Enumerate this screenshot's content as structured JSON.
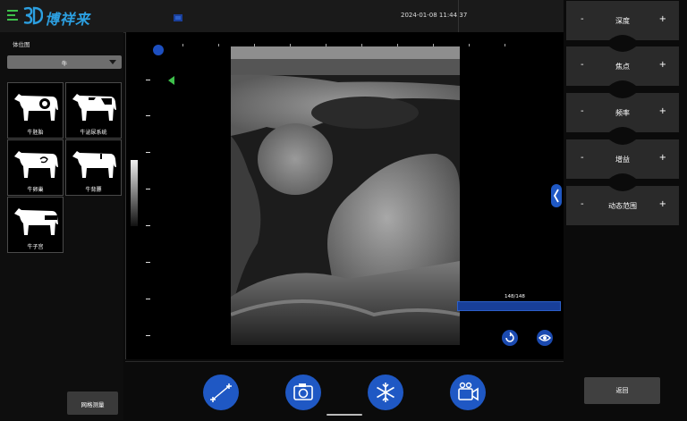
{
  "header": {
    "brand": "博祥来",
    "datetime": "2024-01-08 11:44:37"
  },
  "left_panel": {
    "title": "体位图",
    "selected_animal": "牛",
    "thumbnails": [
      {
        "label": "牛胚胎"
      },
      {
        "label": "牛泌尿系统"
      },
      {
        "label": "牛卵巢"
      },
      {
        "label": "牛背膘"
      },
      {
        "label": "牛子宫"
      }
    ],
    "grid_measure_label": "网格测量"
  },
  "image": {
    "frame_counter": "148/148",
    "cine_progress": 1.0
  },
  "toolbar": {
    "icons": [
      "measure-icon",
      "camera-icon",
      "freeze-icon",
      "video-icon"
    ]
  },
  "controls": {
    "minus": "-",
    "plus": "+",
    "items": [
      {
        "label": "深度"
      },
      {
        "label": "焦点"
      },
      {
        "label": "频率"
      },
      {
        "label": "增益"
      },
      {
        "label": "动态范围"
      }
    ],
    "back_label": "返回"
  },
  "colors": {
    "accent_blue": "#1f58c4",
    "brand_blue": "#2c9fe0",
    "green": "#3ec04b"
  }
}
